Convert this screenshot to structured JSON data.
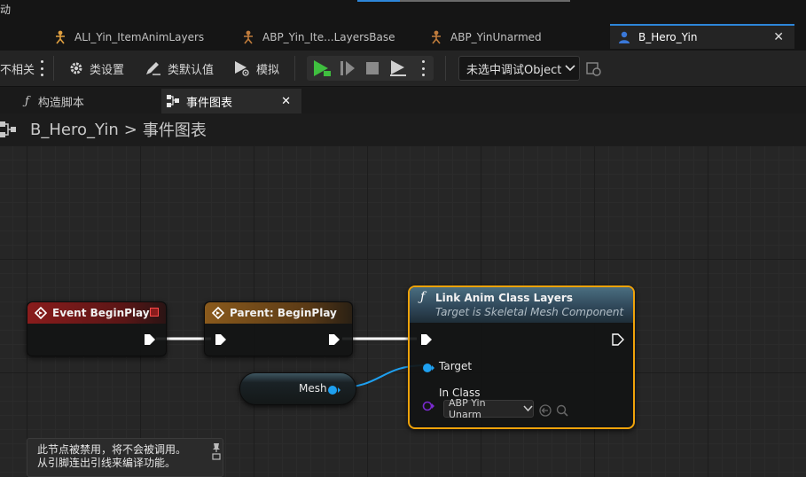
{
  "top_strip": {
    "fragment": "动"
  },
  "asset_tabs": [
    {
      "label": "ALI_Yin_ItemAnimLayers"
    },
    {
      "label": "ABP_Yin_Ite...LayersBase"
    },
    {
      "label": "ABP_YinUnarmed"
    },
    {
      "label": "B_Hero_Yin",
      "active": true
    }
  ],
  "toolbar": {
    "clipped_label": "不相关",
    "class_settings": "类设置",
    "class_defaults": "类默认值",
    "simulate": "模拟",
    "debug_object": "未选中调试Object"
  },
  "doc_tabs": [
    {
      "label": "构造脚本"
    },
    {
      "label": "事件图表",
      "active": true
    }
  ],
  "breadcrumb": {
    "root": "B_Hero_Yin",
    "separator": ">",
    "current": "事件图表"
  },
  "nodes": {
    "event_begin_play": {
      "title": "Event BeginPlay"
    },
    "parent_begin_play": {
      "title": "Parent: BeginPlay"
    },
    "mesh": {
      "label": "Mesh"
    },
    "link_anim": {
      "title": "Link Anim Class Layers",
      "subtitle": "Target is Skeletal Mesh Component",
      "target_label": "Target",
      "in_class_label": "In Class",
      "in_class_value": "ABP Yin Unarm"
    }
  },
  "tooltip": {
    "line1": "此节点被禁用，将不会被调用。",
    "line2": "从引脚连出引线来编译功能。"
  },
  "colors": {
    "accent": "#2d86d9",
    "selection": "#f0a30a",
    "event_header": "#8a1c1c",
    "parent_header": "#7a4a18",
    "function_header": "#3a5a6e",
    "object_pin": "#1ea0f0",
    "class_pin": "#7a2ad0",
    "play_green": "#3fbf3f"
  }
}
